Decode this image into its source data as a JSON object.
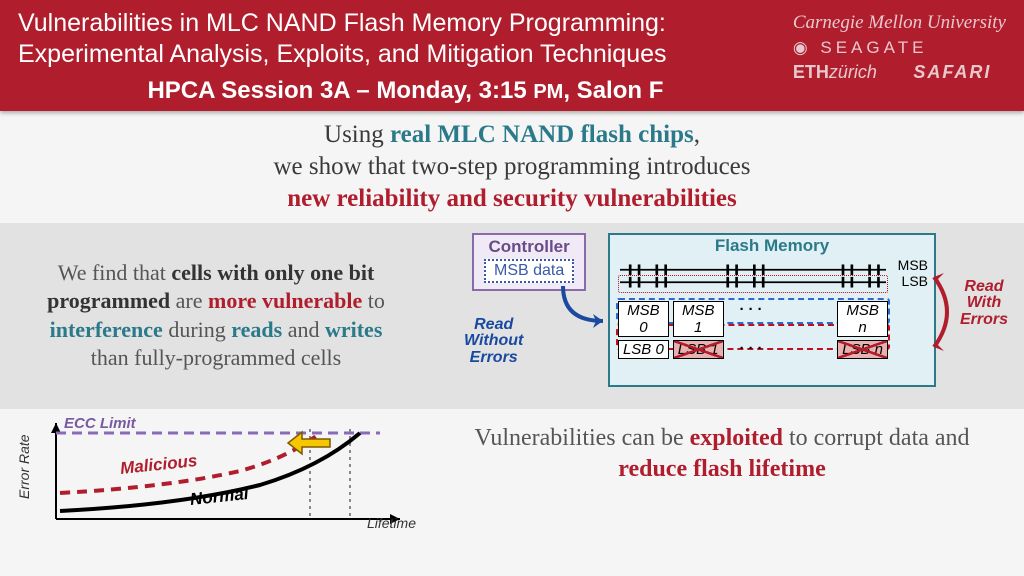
{
  "header": {
    "title_l1": "Vulnerabilities in MLC NAND Flash Memory Programming:",
    "title_l2": "Experimental Analysis, Exploits, and Mitigation Techniques",
    "session_pre": "HPCA Session 3A – Monday, 3:15 ",
    "session_pm": "PM",
    "session_post": ", Salon F",
    "logos": {
      "cmu": "Carnegie Mellon University",
      "seagate": "SEAGATE",
      "eth_bold": "ETH",
      "eth_rest": "zürich",
      "safari": "SAFARI"
    }
  },
  "intro": {
    "p1a": "Using ",
    "p1b": "real MLC NAND flash chips",
    "p1c": ",",
    "p2": "we show that two-step programming introduces",
    "p3": "new reliability and security vulnerabilities"
  },
  "mid": {
    "t1": "We find that ",
    "t2": "cells with only one bit programmed",
    "t3": " are ",
    "t4": "more vulnerable",
    "t5": " to ",
    "t6": "interference",
    "t7": " during ",
    "t8": "reads",
    "t9": " and ",
    "t10": "writes",
    "t11": " than fully-programmed cells"
  },
  "diagram": {
    "controller": "Controller",
    "msb_data": "MSB data",
    "flash": "Flash Memory",
    "msb": "MSB",
    "lsb": "LSB",
    "cells": {
      "m0": "MSB 0",
      "m1": "MSB 1",
      "mn": "MSB n",
      "l0": "LSB 0",
      "l1": "LSB 1",
      "ln": "LSB n"
    },
    "read_no_err_1": "Read",
    "read_no_err_2": "Without",
    "read_no_err_3": "Errors",
    "read_err_1": "Read",
    "read_err_2": "With",
    "read_err_3": "Errors"
  },
  "chart_data": {
    "type": "line",
    "xlabel": "Lifetime",
    "ylabel": "Error Rate",
    "annotations": [
      "ECC Limit",
      "Malicious",
      "Normal"
    ],
    "series": [
      {
        "name": "Normal",
        "x": [
          0,
          0.3,
          0.55,
          0.75,
          0.9,
          1.0
        ],
        "y": [
          0.1,
          0.15,
          0.25,
          0.45,
          0.75,
          0.95
        ]
      },
      {
        "name": "Malicious",
        "x": [
          0,
          0.3,
          0.55,
          0.72,
          0.82
        ],
        "y": [
          0.3,
          0.35,
          0.48,
          0.7,
          0.9
        ]
      },
      {
        "name": "ECC Limit",
        "x": [
          0,
          1.0
        ],
        "y": [
          0.9,
          0.9
        ]
      }
    ],
    "xlim": [
      0,
      1
    ],
    "ylim": [
      0,
      1
    ]
  },
  "bottom": {
    "t1": "Vulnerabilities can be ",
    "t2": "exploited",
    "t3": " to corrupt data and ",
    "t4": "reduce flash lifetime"
  }
}
